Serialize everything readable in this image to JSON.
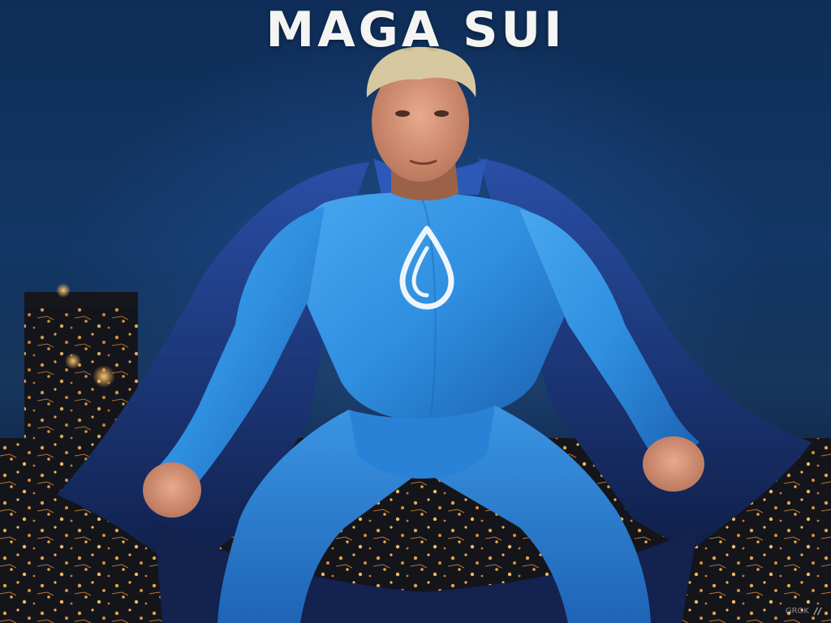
{
  "headline": "MAGA SUI",
  "watermark": {
    "text": "GROK",
    "logo_icon": "grok-logo-icon"
  },
  "emblem": {
    "icon": "sui-droplet-icon"
  },
  "colors": {
    "sky": "#0f2d58",
    "suit": "#2e8ee0",
    "cape": "#1f3f8c",
    "headline": "#f4f4f2",
    "city_lights": "#e8a24a"
  }
}
